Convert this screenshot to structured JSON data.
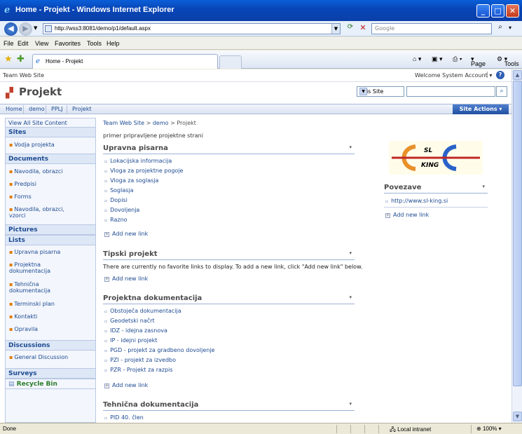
{
  "browser": {
    "window_title": "Home - Projekt - Windows Internet Explorer",
    "address": "http://wss3:8081/demo/p1/default.aspx",
    "search_placeholder": "Google",
    "menu": [
      "File",
      "Edit",
      "View",
      "Favorites",
      "Tools",
      "Help"
    ],
    "tab_label": "Home - Projekt",
    "toolbar": {
      "page": "Page",
      "tools": "Tools"
    },
    "status": {
      "text": "Done",
      "zone": "Local intranet",
      "zoom": "100%"
    }
  },
  "sharepoint": {
    "site_link": "Team Web Site",
    "welcome": "Welcome System Account",
    "site_title": "Projekt",
    "scope": "This Site",
    "nav": [
      "Home",
      "demo",
      "PPLJ",
      "Projekt"
    ],
    "site_actions": "Site Actions",
    "quicklaunch": {
      "view_all": "View All Site Content",
      "sites_head": "Sites",
      "sites": [
        "Vodja projekta"
      ],
      "documents_head": "Documents",
      "documents": [
        "Navodila, obrazci",
        "Predpisi",
        "Forms",
        "Navodila, obrazci, vzorci"
      ],
      "pictures_head": "Pictures",
      "lists_head": "Lists",
      "lists": [
        "Upravna pisarna",
        "Projektna dokumentacija",
        "Tehnična dokumentacija",
        "Terminski plan",
        "Kontakti",
        "Opravila"
      ],
      "discussions_head": "Discussions",
      "discussions": [
        "General Discussion"
      ],
      "surveys_head": "Surveys",
      "recycle": "Recycle Bin"
    },
    "breadcrumb": {
      "a": "Team Web Site",
      "sep": ">",
      "b": "demo",
      "c": "Projekt"
    },
    "page_description": "primer pripravljene projektne strani",
    "add_new_link": "Add new link",
    "webparts": {
      "upravna": {
        "title": "Upravna pisarna",
        "links": [
          "Lokacijska informacija",
          "Vloga za projektne pogoje",
          "Vloga za soglasja",
          "Soglasja",
          "Dopisi",
          "Dovoljenja",
          "Razno"
        ]
      },
      "tipski": {
        "title": "Tipski projekt",
        "empty": "There are currently no favorite links to display. To add a new link, click \"Add new link\" below."
      },
      "projektna": {
        "title": "Projektna dokumentacija",
        "links": [
          "Obstoječa dokumentacija",
          "Geodetski načrt",
          "IDZ - idejna zasnova",
          "IP - idejni projekt",
          "PGD - projekt za gradbeno dovoljenje",
          "PZI - projekt za izvedbo",
          "PZR - Projekt za razpis"
        ]
      },
      "tehnicna": {
        "title": "Tehnična dokumentacija",
        "links": [
          "PID 40. člen"
        ]
      }
    },
    "logo": {
      "top": "SL",
      "bottom": "KING"
    },
    "povezave": {
      "title": "Povezave",
      "links": [
        "http://www.sl-king.si"
      ]
    }
  },
  "colors": {
    "link": "#1d4a91",
    "accent_orange": "#e07d10",
    "titlebar": "#0846b8"
  }
}
